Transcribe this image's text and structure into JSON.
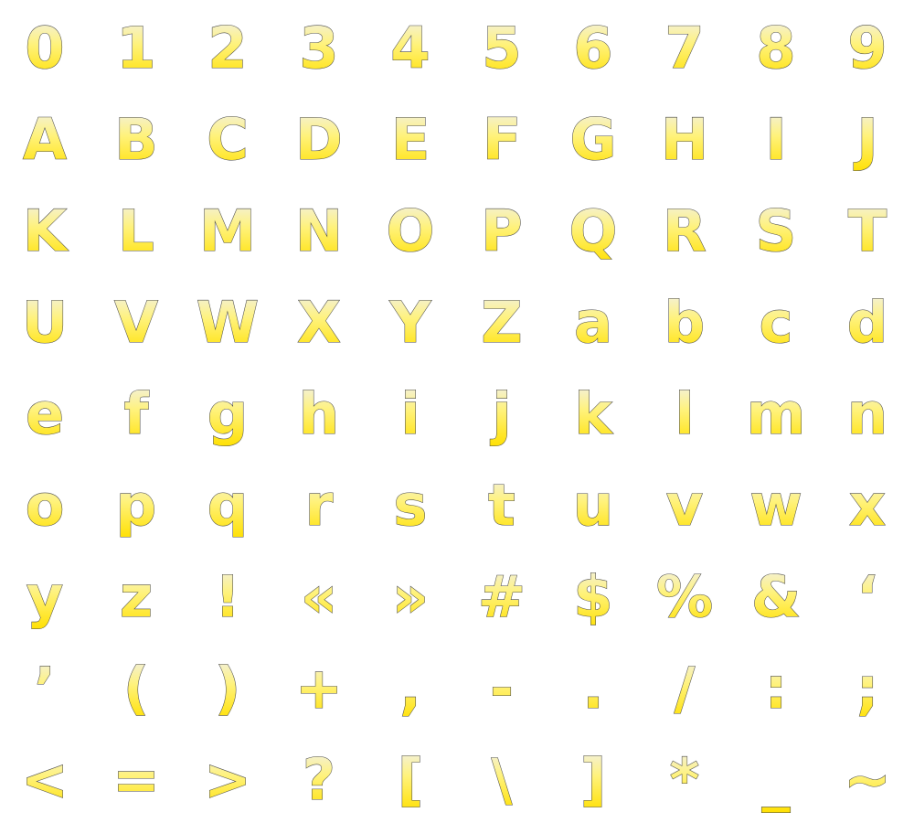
{
  "glyph_sheet": {
    "rows": [
      [
        "0",
        "1",
        "2",
        "3",
        "4",
        "5",
        "6",
        "7",
        "8",
        "9"
      ],
      [
        "A",
        "B",
        "C",
        "D",
        "E",
        "F",
        "G",
        "H",
        "I",
        "J"
      ],
      [
        "K",
        "L",
        "M",
        "N",
        "O",
        "P",
        "Q",
        "R",
        "S",
        "T"
      ],
      [
        "U",
        "V",
        "W",
        "X",
        "Y",
        "Z",
        "a",
        "b",
        "c",
        "d"
      ],
      [
        "e",
        "f",
        "g",
        "h",
        "i",
        "j",
        "k",
        "l",
        "m",
        "n"
      ],
      [
        "o",
        "p",
        "q",
        "r",
        "s",
        "t",
        "u",
        "v",
        "w",
        "x"
      ],
      [
        "y",
        "z",
        "!",
        "«",
        "»",
        "#",
        "$",
        "%",
        "&",
        "‘"
      ],
      [
        "’",
        "(",
        ")",
        "+",
        ",",
        "-",
        ".",
        "/",
        ":",
        ";"
      ],
      [
        "<",
        "=",
        ">",
        "?",
        "[",
        "\\",
        "]",
        "*",
        "_",
        "~"
      ]
    ],
    "colors": {
      "fill_top": "#f0f0f0",
      "fill_bottom": "#ffe000",
      "outline": "#4a4a4a",
      "background": "#ffffff"
    }
  }
}
